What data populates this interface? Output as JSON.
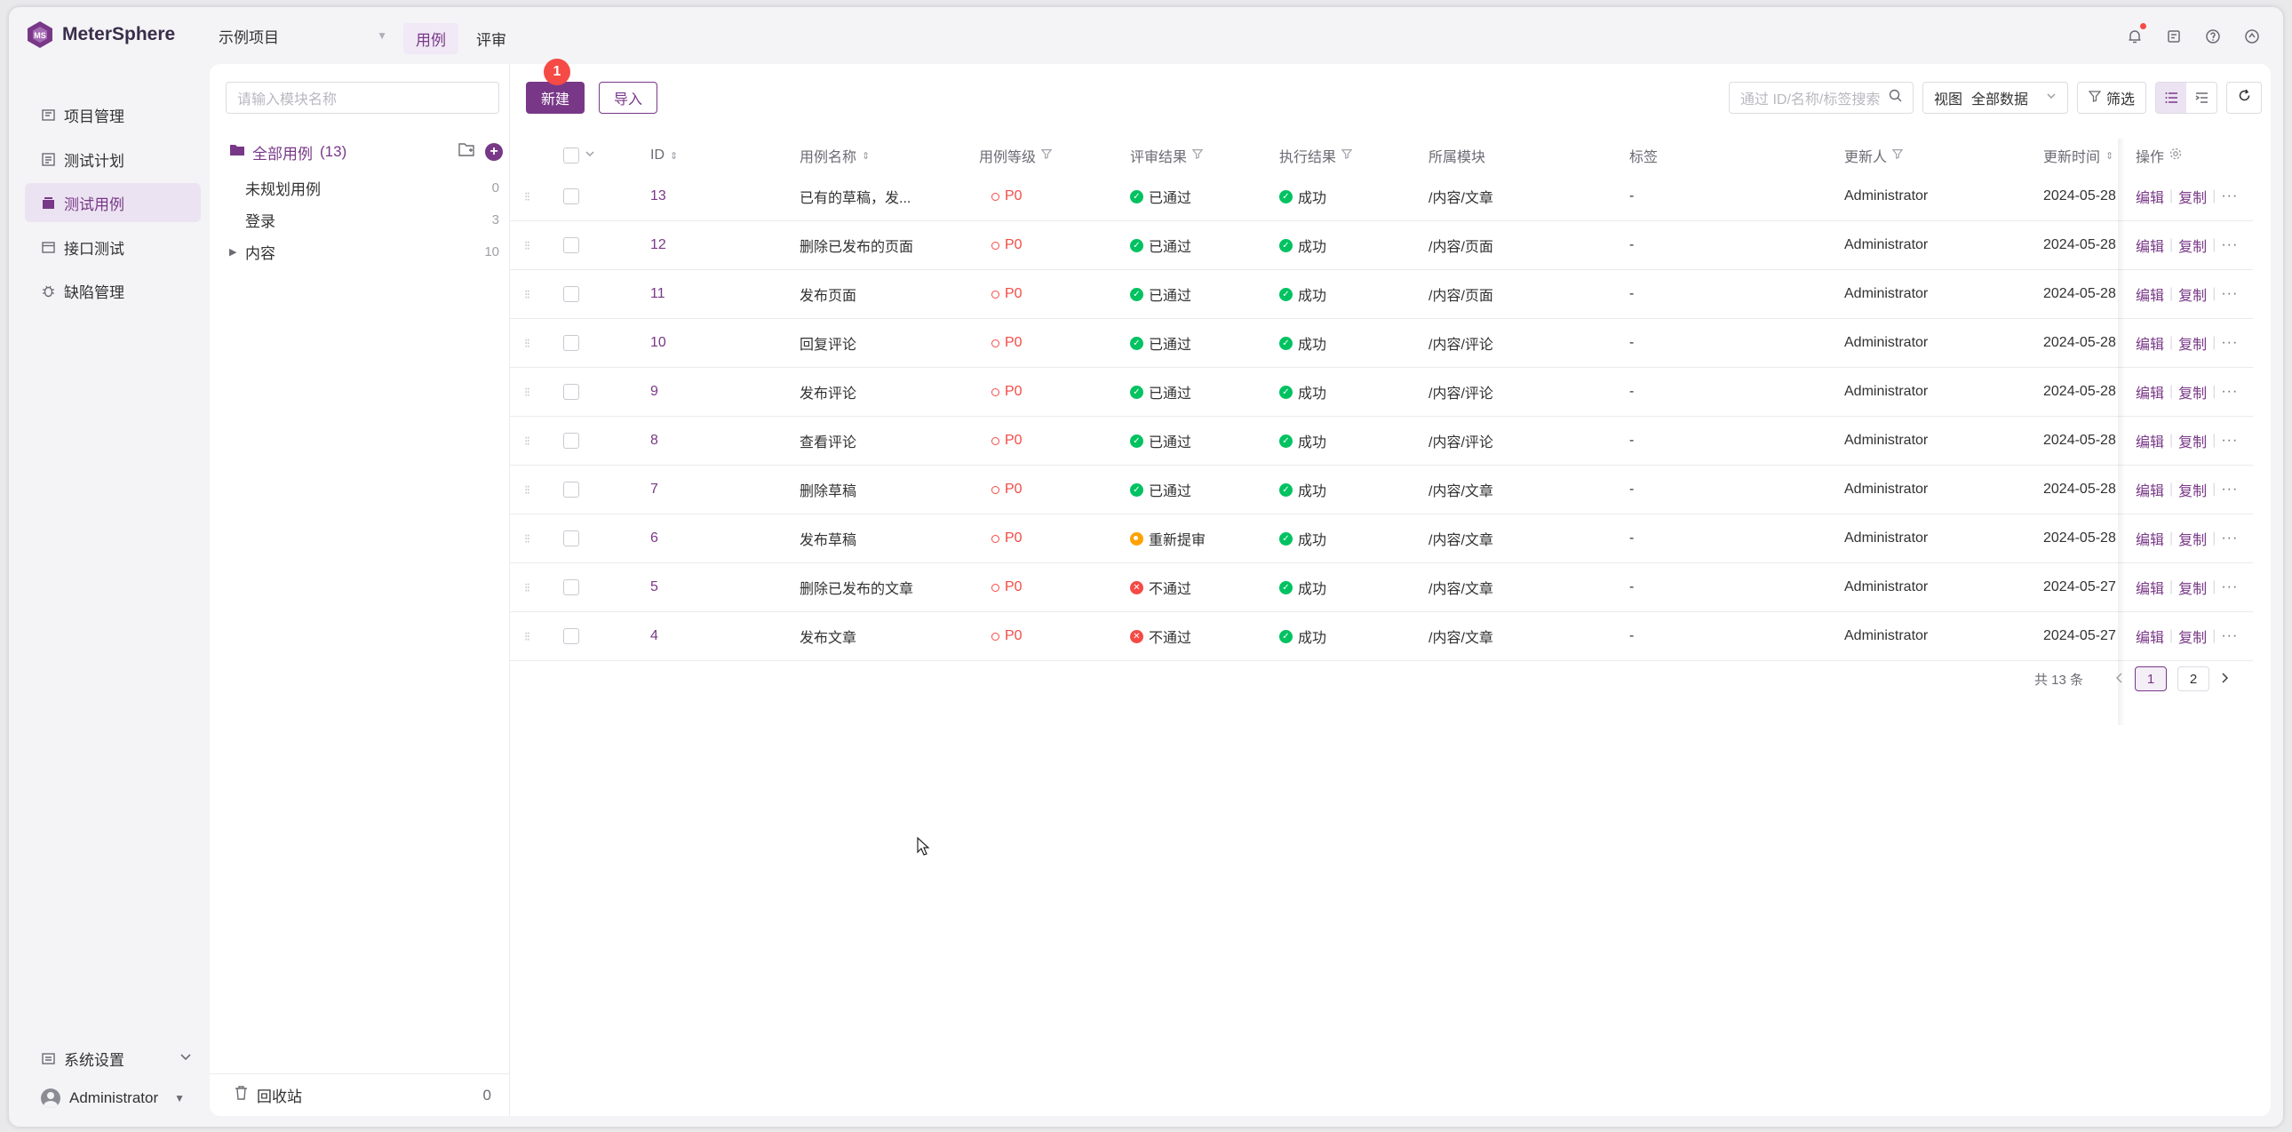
{
  "app": {
    "name": "MeterSphere",
    "accent": "#783887"
  },
  "header": {
    "project": "示例项目",
    "tabs": [
      "用例",
      "评审"
    ],
    "icons": [
      "bell-icon",
      "task-icon",
      "help-icon",
      "sync-icon"
    ]
  },
  "nav": {
    "items": [
      "项目管理",
      "测试计划",
      "测试用例",
      "接口测试",
      "缺陷管理"
    ],
    "active": "测试用例",
    "system_settings": "系统设置",
    "user": "Administrator"
  },
  "tree": {
    "search_placeholder": "请输入模块名称",
    "root_label": "全部用例",
    "root_count": "(13)",
    "items": [
      {
        "label": "未规划用例",
        "count": "0"
      },
      {
        "label": "登录",
        "count": "3"
      },
      {
        "label": "内容",
        "count": "10"
      }
    ],
    "recycle_label": "回收站",
    "recycle_count": "0"
  },
  "toolbar": {
    "new_label": "新建",
    "import_label": "导入",
    "step_badge": "1",
    "search_placeholder": "通过 ID/名称/标签搜索",
    "view_prefix": "视图",
    "view_value": "全部数据",
    "filter_label": "筛选"
  },
  "table": {
    "headers": {
      "id": "ID",
      "name": "用例名称",
      "level": "用例等级",
      "review": "评审结果",
      "exec": "执行结果",
      "module": "所属模块",
      "tags": "标签",
      "updater": "更新人",
      "updated": "更新时间",
      "ops": "操作"
    },
    "op_edit": "编辑",
    "op_copy": "复制",
    "op_more": "···",
    "rows": [
      {
        "id": "13",
        "name": "已有的草稿，发...",
        "level": "P0",
        "review": "已通过",
        "review_status": "pass",
        "exec": "成功",
        "module": "/内容/文章",
        "tags": "-",
        "updater": "Administrator",
        "updated": "2024-05-28"
      },
      {
        "id": "12",
        "name": "删除已发布的页面",
        "level": "P0",
        "review": "已通过",
        "review_status": "pass",
        "exec": "成功",
        "module": "/内容/页面",
        "tags": "-",
        "updater": "Administrator",
        "updated": "2024-05-28"
      },
      {
        "id": "11",
        "name": "发布页面",
        "level": "P0",
        "review": "已通过",
        "review_status": "pass",
        "exec": "成功",
        "module": "/内容/页面",
        "tags": "-",
        "updater": "Administrator",
        "updated": "2024-05-28"
      },
      {
        "id": "10",
        "name": "回复评论",
        "level": "P0",
        "review": "已通过",
        "review_status": "pass",
        "exec": "成功",
        "module": "/内容/评论",
        "tags": "-",
        "updater": "Administrator",
        "updated": "2024-05-28"
      },
      {
        "id": "9",
        "name": "发布评论",
        "level": "P0",
        "review": "已通过",
        "review_status": "pass",
        "exec": "成功",
        "module": "/内容/评论",
        "tags": "-",
        "updater": "Administrator",
        "updated": "2024-05-28"
      },
      {
        "id": "8",
        "name": "查看评论",
        "level": "P0",
        "review": "已通过",
        "review_status": "pass",
        "exec": "成功",
        "module": "/内容/评论",
        "tags": "-",
        "updater": "Administrator",
        "updated": "2024-05-28"
      },
      {
        "id": "7",
        "name": "删除草稿",
        "level": "P0",
        "review": "已通过",
        "review_status": "pass",
        "exec": "成功",
        "module": "/内容/文章",
        "tags": "-",
        "updater": "Administrator",
        "updated": "2024-05-28"
      },
      {
        "id": "6",
        "name": "发布草稿",
        "level": "P0",
        "review": "重新提审",
        "review_status": "resubmit",
        "exec": "成功",
        "module": "/内容/文章",
        "tags": "-",
        "updater": "Administrator",
        "updated": "2024-05-28"
      },
      {
        "id": "5",
        "name": "删除已发布的文章",
        "level": "P0",
        "review": "不通过",
        "review_status": "fail",
        "exec": "成功",
        "module": "/内容/文章",
        "tags": "-",
        "updater": "Administrator",
        "updated": "2024-05-27"
      },
      {
        "id": "4",
        "name": "发布文章",
        "level": "P0",
        "review": "不通过",
        "review_status": "fail",
        "exec": "成功",
        "module": "/内容/文章",
        "tags": "-",
        "updater": "Administrator",
        "updated": "2024-05-27"
      }
    ]
  },
  "pagination": {
    "total": "共 13 条",
    "pages": [
      "1",
      "2"
    ],
    "current": "1"
  }
}
